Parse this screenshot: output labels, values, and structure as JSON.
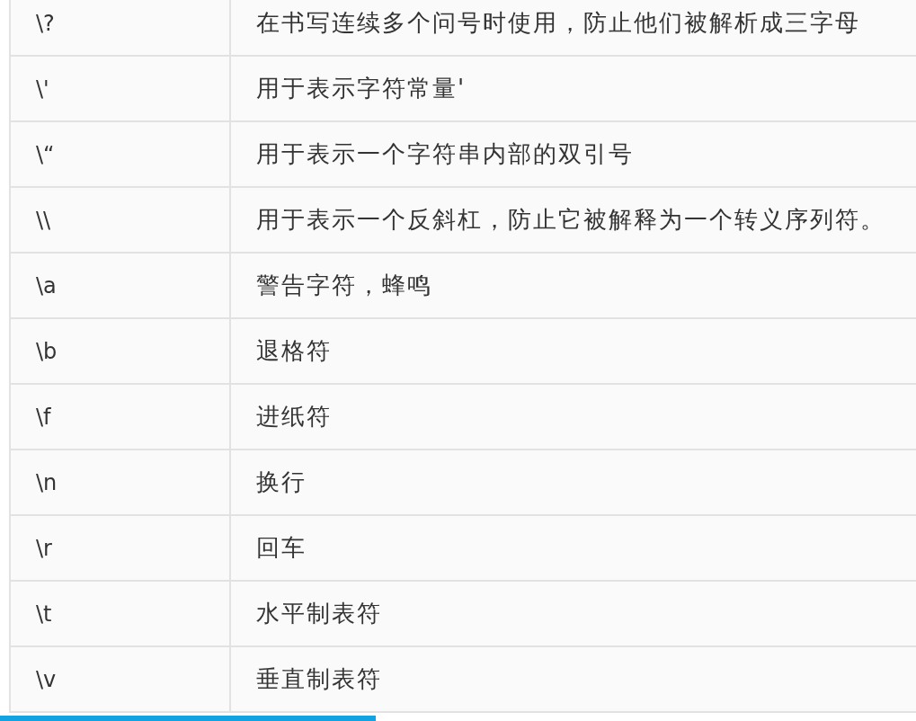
{
  "table": {
    "rows": [
      {
        "escape": "\\?",
        "meaning": "在书写连续多个问号时使用，防止他们被解析成三字母"
      },
      {
        "escape": "\\'",
        "meaning": "用于表示字符常量'"
      },
      {
        "escape": "\\“",
        "meaning": "用于表示一个字符串内部的双引号"
      },
      {
        "escape": "\\\\",
        "meaning": "用于表示一个反斜杠，防止它被解释为一个转义序列符。"
      },
      {
        "escape": "\\a",
        "meaning": "警告字符，蜂鸣"
      },
      {
        "escape": "\\b",
        "meaning": "退格符"
      },
      {
        "escape": "\\f",
        "meaning": "进纸符"
      },
      {
        "escape": "\\n",
        "meaning": "换行"
      },
      {
        "escape": "\\r",
        "meaning": "回车"
      },
      {
        "escape": "\\t",
        "meaning": "水平制表符"
      },
      {
        "escape": "\\v",
        "meaning": "垂直制表符"
      }
    ]
  },
  "player": {
    "progress": {
      "level": 0.41
    }
  }
}
